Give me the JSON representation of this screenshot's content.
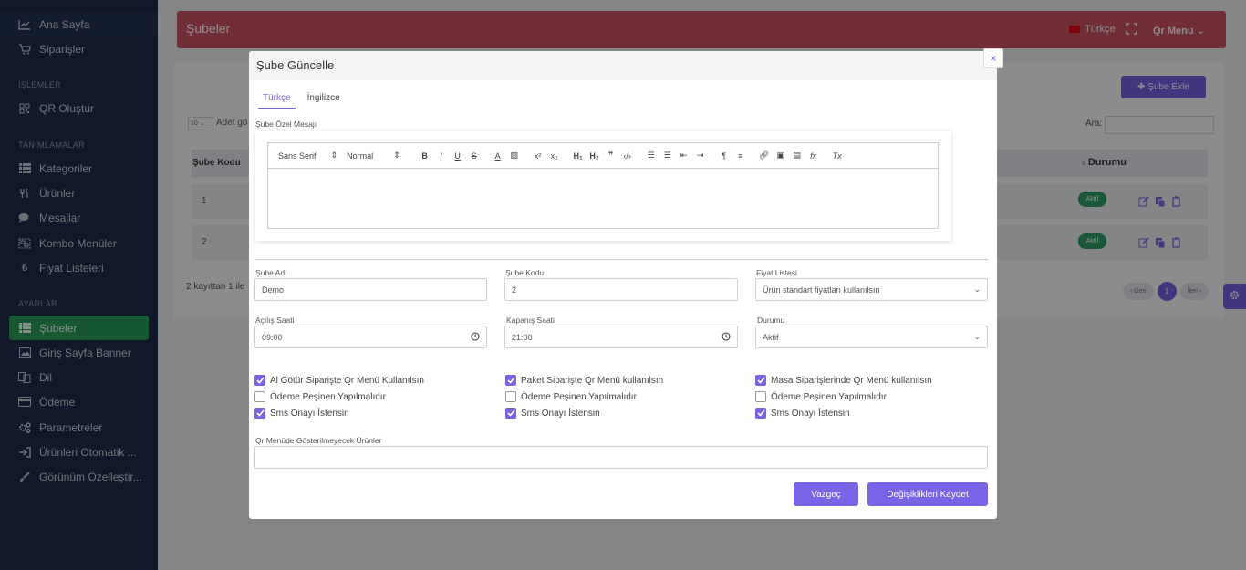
{
  "sidebar": {
    "items": [
      {
        "label": "Ana Sayfa",
        "icon": "chart-line-icon"
      },
      {
        "label": "Siparişler",
        "icon": "cart-icon"
      },
      {
        "label": "QR Oluştur",
        "icon": "qr-icon"
      },
      {
        "label": "Kategoriler",
        "icon": "list-icon"
      },
      {
        "label": "Ürünler",
        "icon": "utensils-icon"
      },
      {
        "label": "Mesajlar",
        "icon": "comments-icon"
      },
      {
        "label": "Kombo Menüler",
        "icon": "object-group-icon"
      },
      {
        "label": "Fiyat Listeleri",
        "icon": "lira-icon"
      },
      {
        "label": "Şubeler",
        "icon": "table-list-icon"
      },
      {
        "label": "Giriş Sayfa Banner",
        "icon": "image-icon"
      },
      {
        "label": "Dil",
        "icon": "language-icon"
      },
      {
        "label": "Ödeme",
        "icon": "credit-card-icon"
      },
      {
        "label": "Parametreler",
        "icon": "cogs-icon"
      },
      {
        "label": "Ürünleri Otomatik ...",
        "icon": "sign-in-icon"
      },
      {
        "label": "Görünüm Özelleştir...",
        "icon": "brush-icon"
      }
    ],
    "headings": {
      "islemler": "İŞLEMLER",
      "tanimlamalar": "TANIMLAMALAR",
      "ayarlar": "AYARLAR"
    }
  },
  "topbar": {
    "title": "Şubeler",
    "language": "Türkçe",
    "menu": "Qr Menu"
  },
  "page": {
    "add_button": "Şube Ekle",
    "search_label": "Ara:",
    "page_length": "10",
    "length_text": "Adet gö",
    "col_kod": "Şube Kodu",
    "col_durum": "Durumu",
    "rows": [
      {
        "id": "1",
        "status": "Aktif"
      },
      {
        "id": "2",
        "status": "Aktif"
      }
    ],
    "info": "2 kayıttan 1 ile",
    "prev": "‹ Geri",
    "current_page": "1",
    "next": "İleri ›"
  },
  "modal": {
    "title": "Şube Güncelle",
    "close": "×",
    "tabs": [
      "Türkçe",
      "İngilizce"
    ],
    "message_label": "Şube Özel Mesajı",
    "toolbar": {
      "font": "Sans Serif",
      "size": "Normal"
    },
    "fields": {
      "sube_adi": {
        "label": "Şube Adı",
        "value": "Demo"
      },
      "sube_kodu": {
        "label": "Şube Kodu",
        "value": "2"
      },
      "fiyat_listesi": {
        "label": "Fiyat Listesi",
        "value": "Ürün standart fiyatları kullanılsın"
      },
      "acilis": {
        "label": "Açılış Saati",
        "value": "09:00"
      },
      "kapanis": {
        "label": "Kapanış Saati",
        "value": "21:00"
      },
      "durumu": {
        "label": "Durumu",
        "value": "Aktif"
      }
    },
    "checkboxes": {
      "col1": [
        {
          "label": "Al Götür Siparişte Qr Menü Kullanılsın",
          "checked": true
        },
        {
          "label": "Ödeme Peşinen Yapılmalıdır",
          "checked": false
        },
        {
          "label": "Sms Onayı İstensin",
          "checked": true
        }
      ],
      "col2": [
        {
          "label": "Paket Siparişte Qr Menü kullanılsın",
          "checked": true
        },
        {
          "label": "Ödeme Peşinen Yapılmalıdır",
          "checked": false
        },
        {
          "label": "Sms Onayı İstensin",
          "checked": true
        }
      ],
      "col3": [
        {
          "label": "Masa Siparişlerinde Qr Menü kullanılsın",
          "checked": true
        },
        {
          "label": "Ödeme Peşinen Yapılmalıdır",
          "checked": false
        },
        {
          "label": "Sms Onayı İstensin",
          "checked": true
        }
      ]
    },
    "hidden_products_label": "Qr Menüde Gösterilmeyecek Ürünler",
    "cancel": "Vazgeç",
    "save": "Değişiklikleri Kaydet"
  },
  "colors": {
    "accent": "#7a63e6",
    "sidebar": "#1e2d4b",
    "topbar": "#d05563",
    "active": "#29a05a"
  }
}
